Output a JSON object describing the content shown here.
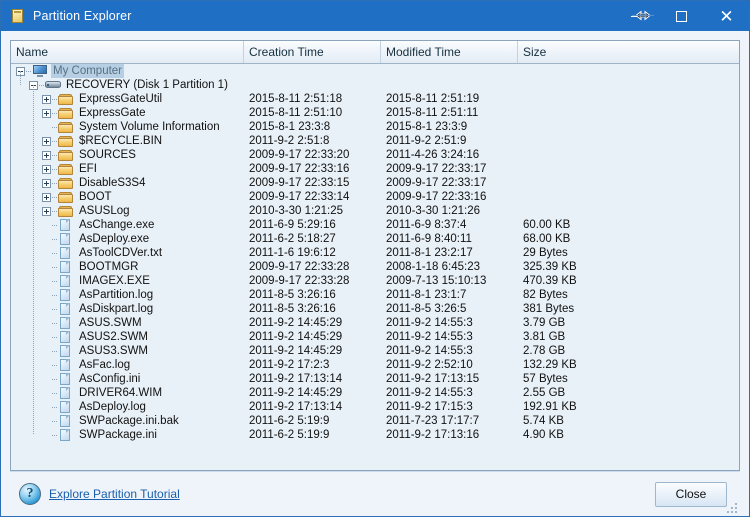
{
  "window": {
    "title": "Partition Explorer",
    "title_icon": "partition-document-icon",
    "accent_color": "#1f6fc4",
    "buttons": {
      "minimize": "minimize-button",
      "maximize": "maximize-button",
      "close": "close-button"
    },
    "cursor": "horizontal-resize-cursor"
  },
  "listview": {
    "columns": [
      {
        "label": "Name"
      },
      {
        "label": "Creation Time"
      },
      {
        "label": "Modified Time"
      },
      {
        "label": "Size"
      }
    ],
    "rows": [
      {
        "name": "My Computer",
        "icon": "monitor-icon",
        "depth": 0,
        "expander": "minus",
        "selected": true,
        "ctime": "",
        "mtime": "",
        "size": ""
      },
      {
        "name": "RECOVERY (Disk 1 Partition 1)",
        "icon": "drive-icon",
        "depth": 1,
        "expander": "minus",
        "selected": false,
        "ctime": "",
        "mtime": "",
        "size": ""
      },
      {
        "name": "ExpressGateUtil",
        "icon": "folder-icon",
        "depth": 2,
        "expander": "plus",
        "selected": false,
        "ctime": "2015-8-11 2:51:18",
        "mtime": "2015-8-11 2:51:19",
        "size": ""
      },
      {
        "name": "ExpressGate",
        "icon": "folder-icon",
        "depth": 2,
        "expander": "plus",
        "selected": false,
        "ctime": "2015-8-11 2:51:10",
        "mtime": "2015-8-11 2:51:11",
        "size": ""
      },
      {
        "name": "System Volume Information",
        "icon": "folder-icon",
        "depth": 2,
        "expander": "none",
        "selected": false,
        "ctime": "2015-8-1 23:3:8",
        "mtime": "2015-8-1 23:3:9",
        "size": ""
      },
      {
        "name": "$RECYCLE.BIN",
        "icon": "folder-icon",
        "depth": 2,
        "expander": "plus",
        "selected": false,
        "ctime": "2011-9-2 2:51:8",
        "mtime": "2011-9-2 2:51:9",
        "size": ""
      },
      {
        "name": "SOURCES",
        "icon": "folder-icon",
        "depth": 2,
        "expander": "plus",
        "selected": false,
        "ctime": "2009-9-17 22:33:20",
        "mtime": "2011-4-26 3:24:16",
        "size": ""
      },
      {
        "name": "EFI",
        "icon": "folder-icon",
        "depth": 2,
        "expander": "plus",
        "selected": false,
        "ctime": "2009-9-17 22:33:16",
        "mtime": "2009-9-17 22:33:17",
        "size": ""
      },
      {
        "name": "DisableS3S4",
        "icon": "folder-icon",
        "depth": 2,
        "expander": "plus",
        "selected": false,
        "ctime": "2009-9-17 22:33:15",
        "mtime": "2009-9-17 22:33:17",
        "size": ""
      },
      {
        "name": "BOOT",
        "icon": "folder-icon",
        "depth": 2,
        "expander": "plus",
        "selected": false,
        "ctime": "2009-9-17 22:33:14",
        "mtime": "2009-9-17 22:33:16",
        "size": ""
      },
      {
        "name": "ASUSLog",
        "icon": "folder-icon",
        "depth": 2,
        "expander": "plus",
        "selected": false,
        "ctime": "2010-3-30 1:21:25",
        "mtime": "2010-3-30 1:21:26",
        "size": ""
      },
      {
        "name": "AsChange.exe",
        "icon": "file-icon",
        "depth": 2,
        "expander": "none",
        "selected": false,
        "ctime": "2011-6-9 5:29:16",
        "mtime": "2011-6-9 8:37:4",
        "size": "60.00 KB"
      },
      {
        "name": "AsDeploy.exe",
        "icon": "file-icon",
        "depth": 2,
        "expander": "none",
        "selected": false,
        "ctime": "2011-6-2 5:18:27",
        "mtime": "2011-6-9 8:40:11",
        "size": "68.00 KB"
      },
      {
        "name": "AsToolCDVer.txt",
        "icon": "file-icon",
        "depth": 2,
        "expander": "none",
        "selected": false,
        "ctime": "2011-1-6 19:6:12",
        "mtime": "2011-8-1 23:2:17",
        "size": "29 Bytes"
      },
      {
        "name": "BOOTMGR",
        "icon": "file-icon",
        "depth": 2,
        "expander": "none",
        "selected": false,
        "ctime": "2009-9-17 22:33:28",
        "mtime": "2008-1-18 6:45:23",
        "size": "325.39 KB"
      },
      {
        "name": "IMAGEX.EXE",
        "icon": "file-icon",
        "depth": 2,
        "expander": "none",
        "selected": false,
        "ctime": "2009-9-17 22:33:28",
        "mtime": "2009-7-13 15:10:13",
        "size": "470.39 KB"
      },
      {
        "name": "AsPartition.log",
        "icon": "file-icon",
        "depth": 2,
        "expander": "none",
        "selected": false,
        "ctime": "2011-8-5 3:26:16",
        "mtime": "2011-8-1 23:1:7",
        "size": "82 Bytes"
      },
      {
        "name": "AsDiskpart.log",
        "icon": "file-icon",
        "depth": 2,
        "expander": "none",
        "selected": false,
        "ctime": "2011-8-5 3:26:16",
        "mtime": "2011-8-5 3:26:5",
        "size": "381 Bytes"
      },
      {
        "name": "ASUS.SWM",
        "icon": "file-icon",
        "depth": 2,
        "expander": "none",
        "selected": false,
        "ctime": "2011-9-2 14:45:29",
        "mtime": "2011-9-2 14:55:3",
        "size": "3.79 GB"
      },
      {
        "name": "ASUS2.SWM",
        "icon": "file-icon",
        "depth": 2,
        "expander": "none",
        "selected": false,
        "ctime": "2011-9-2 14:45:29",
        "mtime": "2011-9-2 14:55:3",
        "size": "3.81 GB"
      },
      {
        "name": "ASUS3.SWM",
        "icon": "file-icon",
        "depth": 2,
        "expander": "none",
        "selected": false,
        "ctime": "2011-9-2 14:45:29",
        "mtime": "2011-9-2 14:55:3",
        "size": "2.78 GB"
      },
      {
        "name": "AsFac.log",
        "icon": "file-icon",
        "depth": 2,
        "expander": "none",
        "selected": false,
        "ctime": "2011-9-2 17:2:3",
        "mtime": "2011-9-2 2:52:10",
        "size": "132.29 KB"
      },
      {
        "name": "AsConfig.ini",
        "icon": "file-icon",
        "depth": 2,
        "expander": "none",
        "selected": false,
        "ctime": "2011-9-2 17:13:14",
        "mtime": "2011-9-2 17:13:15",
        "size": "57 Bytes"
      },
      {
        "name": "DRIVER64.WIM",
        "icon": "file-icon",
        "depth": 2,
        "expander": "none",
        "selected": false,
        "ctime": "2011-9-2 14:45:29",
        "mtime": "2011-9-2 14:55:3",
        "size": "2.55 GB"
      },
      {
        "name": "AsDeploy.log",
        "icon": "file-icon",
        "depth": 2,
        "expander": "none",
        "selected": false,
        "ctime": "2011-9-2 17:13:14",
        "mtime": "2011-9-2 17:15:3",
        "size": "192.91 KB"
      },
      {
        "name": "SWPackage.ini.bak",
        "icon": "file-icon",
        "depth": 2,
        "expander": "none",
        "selected": false,
        "ctime": "2011-6-2 5:19:9",
        "mtime": "2011-7-23 17:17:7",
        "size": "5.74 KB"
      },
      {
        "name": "SWPackage.ini",
        "icon": "file-icon",
        "depth": 2,
        "expander": "none",
        "selected": false,
        "ctime": "2011-6-2 5:19:9",
        "mtime": "2011-9-2 17:13:16",
        "size": "4.90 KB"
      }
    ]
  },
  "footer": {
    "help_icon": "question-mark-help-icon",
    "help_link": "Explore Partition Tutorial",
    "close_label": "Close",
    "grip": "resize-grip"
  }
}
